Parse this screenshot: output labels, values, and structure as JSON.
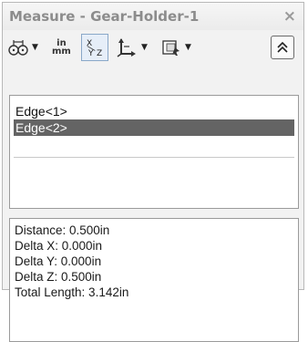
{
  "window": {
    "title": "Measure - Gear-Holder-1",
    "close_glyph": "×"
  },
  "toolbar": {
    "arc_options": {
      "icon": "arc-circle-options-icon"
    },
    "units": {
      "top": "in",
      "bottom": "mm"
    },
    "xyz": {
      "icon": "xyz-measurement-icon",
      "x": "X",
      "y": "Y",
      "z": "Z",
      "active": true
    },
    "projection": {
      "icon": "projection-icon"
    },
    "history": {
      "icon": "measure-history-icon"
    },
    "collapse": {
      "icon": "collapse-up-icon"
    }
  },
  "selections": [
    {
      "label": "Edge<1>",
      "selected": false
    },
    {
      "label": "Edge<2>",
      "selected": true
    }
  ],
  "results": [
    {
      "label": "Distance: 0.500in"
    },
    {
      "label": "Delta X: 0.000in"
    },
    {
      "label": "Delta Y: 0.000in"
    },
    {
      "label": "Delta Z: 0.500in"
    },
    {
      "label": "Total Length: 3.142in"
    }
  ],
  "colors": {
    "selected_row": "#646464",
    "title_text": "#8c8c8c"
  }
}
